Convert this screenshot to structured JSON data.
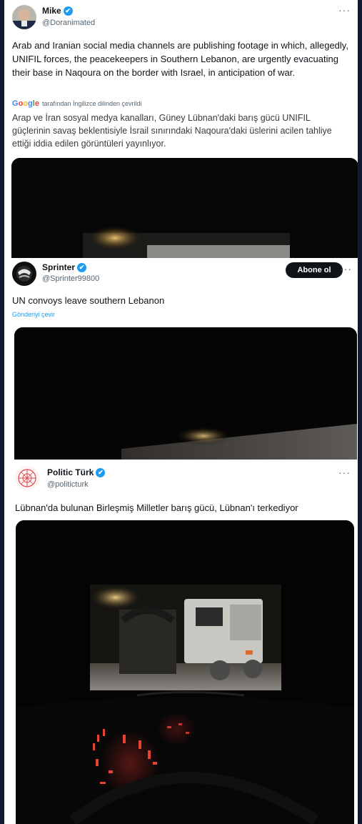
{
  "tweets": [
    {
      "name": "Mike",
      "handle": "@Doranimated",
      "text": "Arab and Iranian social media channels are publishing footage in which, allegedly, UNIFIL forces, the peacekeepers in Southern Lebanon, are urgently evacuating their base in Naqoura on the border with Israel, in anticipation of war.",
      "translation_brand": "Google",
      "translation_note": "tarafından İngilizce dilinden çevrildi",
      "translated_text": "Arap ve İran sosyal medya kanalları, Güney Lübnan'daki barış gücü UNIFIL güçlerinin savaş beklentisiyle İsrail sınırındaki Naqoura'daki üslerini acilen tahliye ettiği iddia edilen görüntüleri yayınlıyor.",
      "more": "···"
    },
    {
      "name": "Sprinter",
      "handle": "@Sprinter99800",
      "follow_label": "Abone ol",
      "text": "UN convoys leave southern Lebanon",
      "translate_link": "Gönderiyi çevir",
      "more": "···"
    },
    {
      "name": "Politic Türk",
      "handle": "@politicturk",
      "text": "Lübnan'da bulunan Birleşmiş Milletler barış gücü, Lübnan'ı terkediyor",
      "more": "···"
    }
  ],
  "icons": {
    "verified": "✔"
  },
  "colors": {
    "verified": "#1d9bf0",
    "link": "#1d9bf0",
    "follow_button": "#0f1419",
    "backdrop": "#0f1b2e"
  }
}
